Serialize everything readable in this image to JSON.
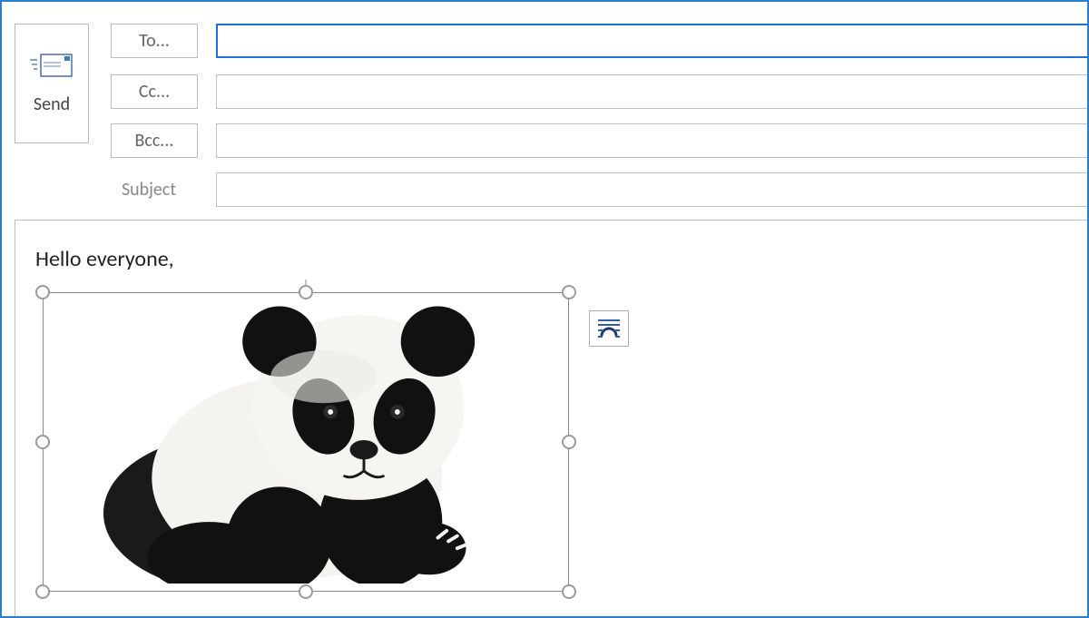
{
  "send": {
    "label": "Send"
  },
  "fields": {
    "to_label": "To...",
    "cc_label": "Cc...",
    "bcc_label": "Bcc...",
    "subject_label": "Subject",
    "to_value": "",
    "cc_value": "",
    "bcc_value": "",
    "subject_value": ""
  },
  "body": {
    "greeting": "Hello everyone,",
    "attachment_name": "panda-image"
  },
  "icons": {
    "layout_options": "layout-options-icon",
    "envelope": "envelope-send-icon"
  }
}
